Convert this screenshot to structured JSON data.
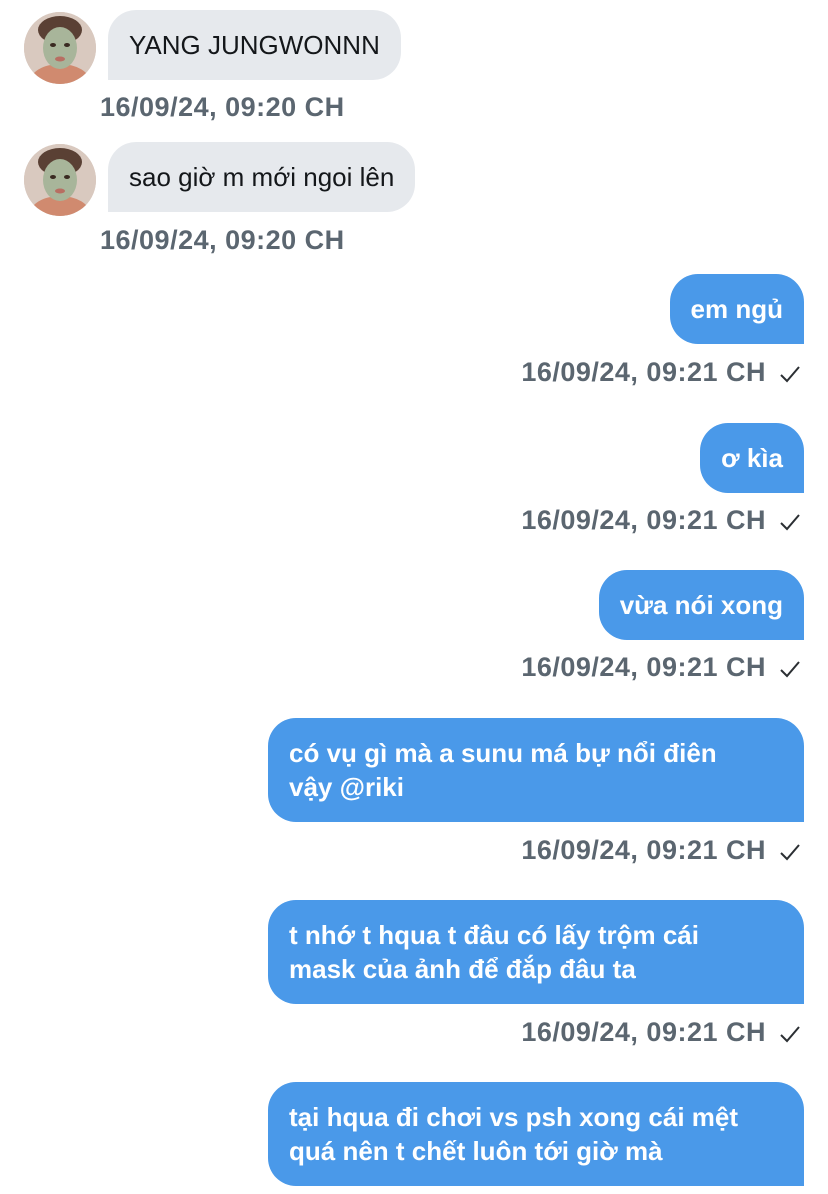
{
  "conversation": {
    "messages": [
      {
        "direction": "in",
        "text": "YANG JUNGWONNN",
        "time": "16/09/24, 09:20 CH",
        "avatar": "face-mask-avatar"
      },
      {
        "direction": "in",
        "text": "sao giờ m mới ngoi lên",
        "time": "16/09/24, 09:20 CH",
        "avatar": "face-mask-avatar"
      },
      {
        "direction": "out",
        "text": "em ngủ",
        "time": "16/09/24, 09:21 CH",
        "status": "check-icon"
      },
      {
        "direction": "out",
        "text": "ơ kìa",
        "time": "16/09/24, 09:21 CH",
        "status": "check-icon"
      },
      {
        "direction": "out",
        "text": "vừa nói xong",
        "time": "16/09/24, 09:21 CH",
        "status": "check-icon"
      },
      {
        "direction": "out",
        "text": "có vụ gì mà a sunu má bự nổi điên\nvậy @riki",
        "time": "16/09/24, 09:21 CH",
        "status": "check-icon"
      },
      {
        "direction": "out",
        "text": "t nhớ t hqua t đâu có lấy trộm cái\nmask của ảnh để đắp đâu ta",
        "time": "16/09/24, 09:21 CH",
        "status": "check-icon"
      },
      {
        "direction": "out",
        "text": "tại hqua đi chơi vs psh xong cái mệt\nquá nên t chết luôn tới giờ mà"
      }
    ]
  },
  "colors": {
    "incoming_bubble": "#e6e9ed",
    "outgoing_bubble": "#4a99e9",
    "timestamp": "#5b6670"
  }
}
